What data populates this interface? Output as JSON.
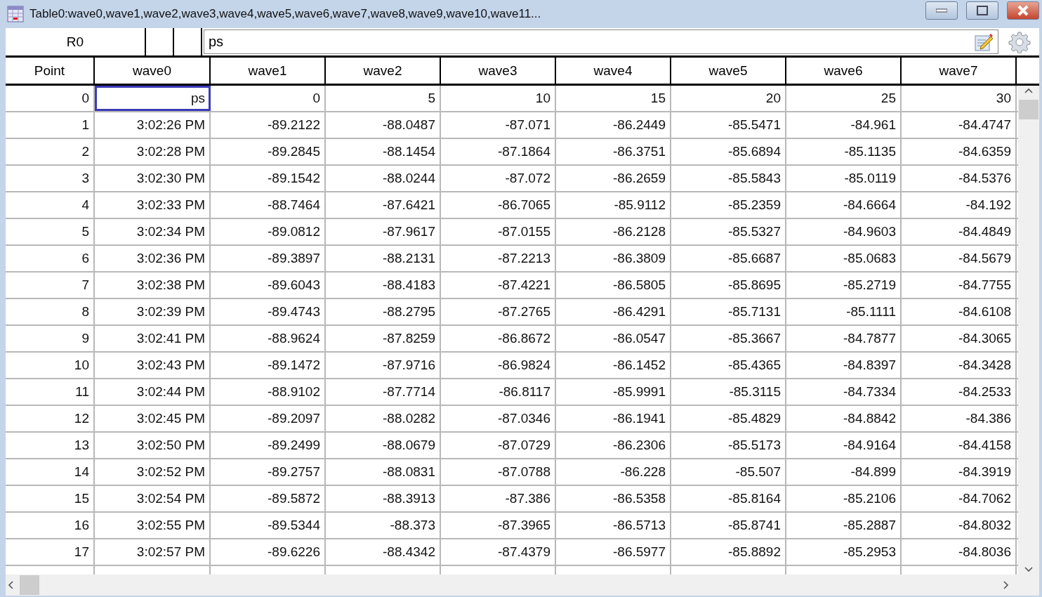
{
  "window": {
    "title": "Table0:wave0,wave1,wave2,wave3,wave4,wave5,wave6,wave7,wave8,wave9,wave10,wave11..."
  },
  "toolbar": {
    "cell_name": "R0",
    "entry_value": "ps"
  },
  "table": {
    "columns": [
      "Point",
      "wave0",
      "wave1",
      "wave2",
      "wave3",
      "wave4",
      "wave5",
      "wave6",
      "wave7"
    ],
    "rows": [
      {
        "cells": [
          {
            "text": "0",
            "selected": false
          },
          {
            "text": "ps",
            "selected": true
          },
          {
            "text": "0",
            "selected": false
          },
          {
            "text": "5",
            "selected": false
          },
          {
            "text": "10",
            "selected": false
          },
          {
            "text": "15",
            "selected": false
          },
          {
            "text": "20",
            "selected": false
          },
          {
            "text": "25",
            "selected": false
          },
          {
            "text": "30",
            "selected": false
          }
        ]
      },
      {
        "cells": [
          {
            "text": "1",
            "selected": false
          },
          {
            "text": "3:02:26 PM",
            "selected": false
          },
          {
            "text": "-89.2122",
            "selected": false
          },
          {
            "text": "-88.0487",
            "selected": false
          },
          {
            "text": "-87.071",
            "selected": false
          },
          {
            "text": "-86.2449",
            "selected": false
          },
          {
            "text": "-85.5471",
            "selected": false
          },
          {
            "text": "-84.961",
            "selected": false
          },
          {
            "text": "-84.4747",
            "selected": false
          }
        ]
      },
      {
        "cells": [
          {
            "text": "2",
            "selected": false
          },
          {
            "text": "3:02:28 PM",
            "selected": false
          },
          {
            "text": "-89.2845",
            "selected": false
          },
          {
            "text": "-88.1454",
            "selected": false
          },
          {
            "text": "-87.1864",
            "selected": false
          },
          {
            "text": "-86.3751",
            "selected": false
          },
          {
            "text": "-85.6894",
            "selected": false
          },
          {
            "text": "-85.1135",
            "selected": false
          },
          {
            "text": "-84.6359",
            "selected": false
          }
        ]
      },
      {
        "cells": [
          {
            "text": "3",
            "selected": false
          },
          {
            "text": "3:02:30 PM",
            "selected": false
          },
          {
            "text": "-89.1542",
            "selected": false
          },
          {
            "text": "-88.0244",
            "selected": false
          },
          {
            "text": "-87.072",
            "selected": false
          },
          {
            "text": "-86.2659",
            "selected": false
          },
          {
            "text": "-85.5843",
            "selected": false
          },
          {
            "text": "-85.0119",
            "selected": false
          },
          {
            "text": "-84.5376",
            "selected": false
          }
        ]
      },
      {
        "cells": [
          {
            "text": "4",
            "selected": false
          },
          {
            "text": "3:02:33 PM",
            "selected": false
          },
          {
            "text": "-88.7464",
            "selected": false
          },
          {
            "text": "-87.6421",
            "selected": false
          },
          {
            "text": "-86.7065",
            "selected": false
          },
          {
            "text": "-85.9112",
            "selected": false
          },
          {
            "text": "-85.2359",
            "selected": false
          },
          {
            "text": "-84.6664",
            "selected": false
          },
          {
            "text": "-84.192",
            "selected": false
          }
        ]
      },
      {
        "cells": [
          {
            "text": "5",
            "selected": false
          },
          {
            "text": "3:02:34 PM",
            "selected": false
          },
          {
            "text": "-89.0812",
            "selected": false
          },
          {
            "text": "-87.9617",
            "selected": false
          },
          {
            "text": "-87.0155",
            "selected": false
          },
          {
            "text": "-86.2128",
            "selected": false
          },
          {
            "text": "-85.5327",
            "selected": false
          },
          {
            "text": "-84.9603",
            "selected": false
          },
          {
            "text": "-84.4849",
            "selected": false
          }
        ]
      },
      {
        "cells": [
          {
            "text": "6",
            "selected": false
          },
          {
            "text": "3:02:36 PM",
            "selected": false
          },
          {
            "text": "-89.3897",
            "selected": false
          },
          {
            "text": "-88.2131",
            "selected": false
          },
          {
            "text": "-87.2213",
            "selected": false
          },
          {
            "text": "-86.3809",
            "selected": false
          },
          {
            "text": "-85.6687",
            "selected": false
          },
          {
            "text": "-85.0683",
            "selected": false
          },
          {
            "text": "-84.5679",
            "selected": false
          }
        ]
      },
      {
        "cells": [
          {
            "text": "7",
            "selected": false
          },
          {
            "text": "3:02:38 PM",
            "selected": false
          },
          {
            "text": "-89.6043",
            "selected": false
          },
          {
            "text": "-88.4183",
            "selected": false
          },
          {
            "text": "-87.4221",
            "selected": false
          },
          {
            "text": "-86.5805",
            "selected": false
          },
          {
            "text": "-85.8695",
            "selected": false
          },
          {
            "text": "-85.2719",
            "selected": false
          },
          {
            "text": "-84.7755",
            "selected": false
          }
        ]
      },
      {
        "cells": [
          {
            "text": "8",
            "selected": false
          },
          {
            "text": "3:02:39 PM",
            "selected": false
          },
          {
            "text": "-89.4743",
            "selected": false
          },
          {
            "text": "-88.2795",
            "selected": false
          },
          {
            "text": "-87.2765",
            "selected": false
          },
          {
            "text": "-86.4291",
            "selected": false
          },
          {
            "text": "-85.7131",
            "selected": false
          },
          {
            "text": "-85.1111",
            "selected": false
          },
          {
            "text": "-84.6108",
            "selected": false
          }
        ]
      },
      {
        "cells": [
          {
            "text": "9",
            "selected": false
          },
          {
            "text": "3:02:41 PM",
            "selected": false
          },
          {
            "text": "-88.9624",
            "selected": false
          },
          {
            "text": "-87.8259",
            "selected": false
          },
          {
            "text": "-86.8672",
            "selected": false
          },
          {
            "text": "-86.0547",
            "selected": false
          },
          {
            "text": "-85.3667",
            "selected": false
          },
          {
            "text": "-84.7877",
            "selected": false
          },
          {
            "text": "-84.3065",
            "selected": false
          }
        ]
      },
      {
        "cells": [
          {
            "text": "10",
            "selected": false
          },
          {
            "text": "3:02:43 PM",
            "selected": false
          },
          {
            "text": "-89.1472",
            "selected": false
          },
          {
            "text": "-87.9716",
            "selected": false
          },
          {
            "text": "-86.9824",
            "selected": false
          },
          {
            "text": "-86.1452",
            "selected": false
          },
          {
            "text": "-85.4365",
            "selected": false
          },
          {
            "text": "-84.8397",
            "selected": false
          },
          {
            "text": "-84.3428",
            "selected": false
          }
        ]
      },
      {
        "cells": [
          {
            "text": "11",
            "selected": false
          },
          {
            "text": "3:02:44 PM",
            "selected": false
          },
          {
            "text": "-88.9102",
            "selected": false
          },
          {
            "text": "-87.7714",
            "selected": false
          },
          {
            "text": "-86.8117",
            "selected": false
          },
          {
            "text": "-85.9991",
            "selected": false
          },
          {
            "text": "-85.3115",
            "selected": false
          },
          {
            "text": "-84.7334",
            "selected": false
          },
          {
            "text": "-84.2533",
            "selected": false
          }
        ]
      },
      {
        "cells": [
          {
            "text": "12",
            "selected": false
          },
          {
            "text": "3:02:45 PM",
            "selected": false
          },
          {
            "text": "-89.2097",
            "selected": false
          },
          {
            "text": "-88.0282",
            "selected": false
          },
          {
            "text": "-87.0346",
            "selected": false
          },
          {
            "text": "-86.1941",
            "selected": false
          },
          {
            "text": "-85.4829",
            "selected": false
          },
          {
            "text": "-84.8842",
            "selected": false
          },
          {
            "text": "-84.386",
            "selected": false
          }
        ]
      },
      {
        "cells": [
          {
            "text": "13",
            "selected": false
          },
          {
            "text": "3:02:50 PM",
            "selected": false
          },
          {
            "text": "-89.2499",
            "selected": false
          },
          {
            "text": "-88.0679",
            "selected": false
          },
          {
            "text": "-87.0729",
            "selected": false
          },
          {
            "text": "-86.2306",
            "selected": false
          },
          {
            "text": "-85.5173",
            "selected": false
          },
          {
            "text": "-84.9164",
            "selected": false
          },
          {
            "text": "-84.4158",
            "selected": false
          }
        ]
      },
      {
        "cells": [
          {
            "text": "14",
            "selected": false
          },
          {
            "text": "3:02:52 PM",
            "selected": false
          },
          {
            "text": "-89.2757",
            "selected": false
          },
          {
            "text": "-88.0831",
            "selected": false
          },
          {
            "text": "-87.0788",
            "selected": false
          },
          {
            "text": "-86.228",
            "selected": false
          },
          {
            "text": "-85.507",
            "selected": false
          },
          {
            "text": "-84.899",
            "selected": false
          },
          {
            "text": "-84.3919",
            "selected": false
          }
        ]
      },
      {
        "cells": [
          {
            "text": "15",
            "selected": false
          },
          {
            "text": "3:02:54 PM",
            "selected": false
          },
          {
            "text": "-89.5872",
            "selected": false
          },
          {
            "text": "-88.3913",
            "selected": false
          },
          {
            "text": "-87.386",
            "selected": false
          },
          {
            "text": "-86.5358",
            "selected": false
          },
          {
            "text": "-85.8164",
            "selected": false
          },
          {
            "text": "-85.2106",
            "selected": false
          },
          {
            "text": "-84.7062",
            "selected": false
          }
        ]
      },
      {
        "cells": [
          {
            "text": "16",
            "selected": false
          },
          {
            "text": "3:02:55 PM",
            "selected": false
          },
          {
            "text": "-89.5344",
            "selected": false
          },
          {
            "text": "-88.373",
            "selected": false
          },
          {
            "text": "-87.3965",
            "selected": false
          },
          {
            "text": "-86.5713",
            "selected": false
          },
          {
            "text": "-85.8741",
            "selected": false
          },
          {
            "text": "-85.2887",
            "selected": false
          },
          {
            "text": "-84.8032",
            "selected": false
          }
        ]
      },
      {
        "cells": [
          {
            "text": "17",
            "selected": false
          },
          {
            "text": "3:02:57 PM",
            "selected": false
          },
          {
            "text": "-89.6226",
            "selected": false
          },
          {
            "text": "-88.4342",
            "selected": false
          },
          {
            "text": "-87.4379",
            "selected": false
          },
          {
            "text": "-86.5977",
            "selected": false
          },
          {
            "text": "-85.8892",
            "selected": false
          },
          {
            "text": "-85.2953",
            "selected": false
          },
          {
            "text": "-84.8036",
            "selected": false
          }
        ]
      }
    ]
  }
}
